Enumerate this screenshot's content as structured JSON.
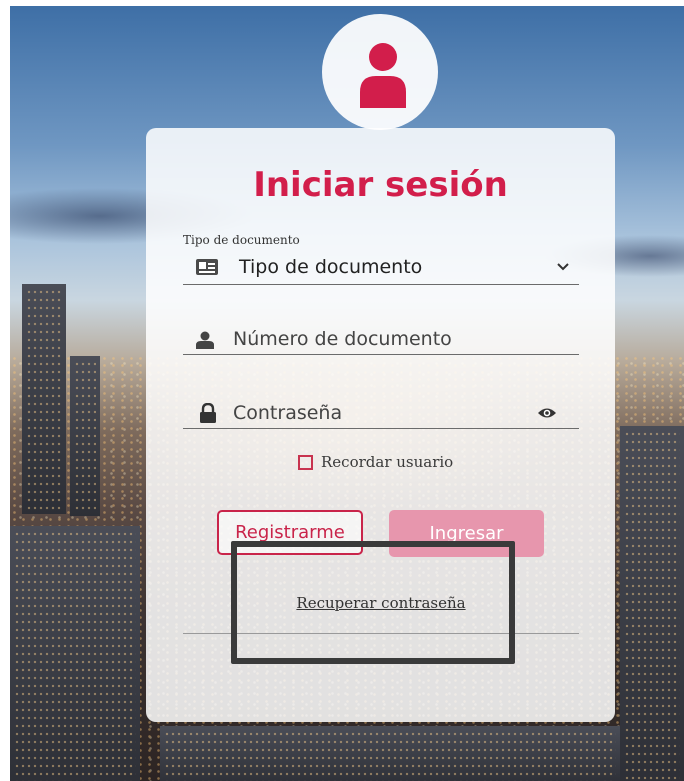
{
  "header": {
    "avatar_icon": "user-icon",
    "title": "Iniciar sesión"
  },
  "form": {
    "doc_type_label": "Tipo de documento",
    "doc_type_value": "Tipo de documento",
    "doc_type_icon": "id-card-icon",
    "doc_number_placeholder": "Número de documento",
    "doc_number_icon": "user-icon",
    "password_placeholder": "Contraseña",
    "password_icon": "lock-icon",
    "show_password_icon": "eye-icon",
    "remember_label": "Recordar usuario",
    "remember_checked": false
  },
  "actions": {
    "register_label": "Registrarme",
    "login_label": "Ingresar",
    "recover_label": "Recuperar contraseña"
  },
  "colors": {
    "brand": "#d21e4b",
    "login_button_disabled": "#e796ad",
    "highlight_box": "#3a3a3a"
  }
}
